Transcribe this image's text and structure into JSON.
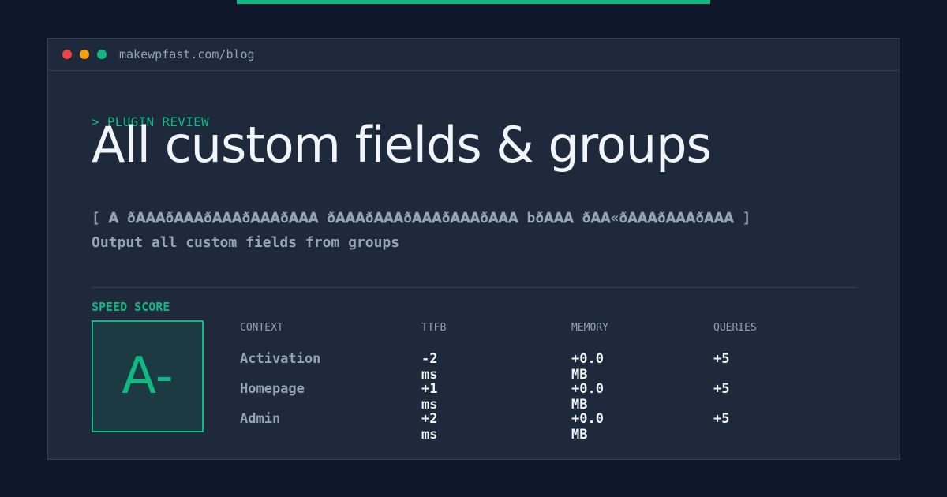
{
  "window": {
    "url": "makewpfast.com/blog",
    "controls": {
      "close_color": "#ef4444",
      "minimize_color": "#f59e0b",
      "maximize_color": "#10b981"
    }
  },
  "article": {
    "kicker": "> PLUGIN REVIEW",
    "title": "All custom fields & groups",
    "description_line1": "[ 𝐀 ð𝐀𝐀𝐀ð𝐀𝐀𝐀ð𝐀𝐀𝐀ð𝐀𝐀𝐀ð𝐀𝐀𝐀 ð𝐀𝐀𝐀ð𝐀𝐀𝐀ð𝐀𝐀𝐀ð𝐀𝐀𝐀ð𝐀𝐀𝐀 bð𝐀𝐀𝐀 ð𝐀𝐀«ð𝐀𝐀𝐀ð𝐀𝐀𝐀ð𝐀𝐀𝐀 ]",
    "description_line2": "Output all custom fields from groups"
  },
  "speed": {
    "label": "SPEED SCORE",
    "grade": "A-",
    "accent": "#10b981"
  },
  "table": {
    "headers": [
      "CONTEXT",
      "TTFB",
      "MEMORY",
      "QUERIES"
    ],
    "rows": [
      [
        "Activation",
        "-2 ms",
        "+0.0 MB",
        "+5"
      ],
      [
        "Homepage",
        "+1 ms",
        "+0.0 MB",
        "+5"
      ],
      [
        "Admin",
        "+2 ms",
        "+0.0 MB",
        "+5"
      ]
    ]
  }
}
